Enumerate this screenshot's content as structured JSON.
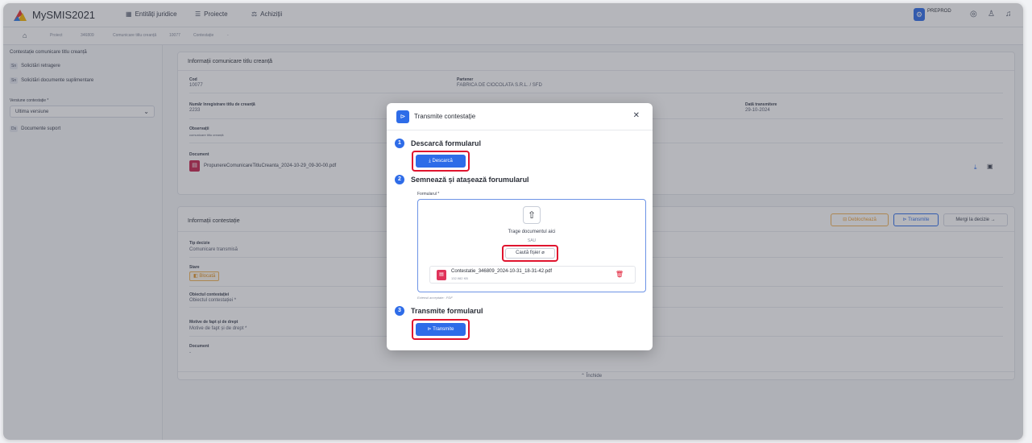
{
  "app": {
    "title": "MySMIS2021"
  },
  "nav": {
    "items": [
      "Entități juridice",
      "Proiecte",
      "Achiziții"
    ]
  },
  "topright": {
    "env_label": "PREPROD"
  },
  "breadcrumb": [
    "Proiect",
    "346809",
    "Comunicare titlu creanță",
    "10077",
    "Contestație",
    "-"
  ],
  "sidebar": {
    "title": "Contestație comunicare titlu creanță",
    "items": [
      {
        "tag": "Sn",
        "label": "Solicitări retragere"
      },
      {
        "tag": "Sn",
        "label": "Solicitări documente suplimentare"
      }
    ],
    "version_label": "Versiune contestație *",
    "version_value": "Ultima versiune",
    "docs_tag": "Ds",
    "docs_label": "Documente suport"
  },
  "info_card": {
    "title": "Informații comunicare titlu creanță",
    "cod_label": "Cod",
    "cod_value": "10077",
    "partener_label": "Partener",
    "partener_value": "FABRICA DE CIOCOLATA S.R.L. / SFD",
    "nr_label": "Număr înregistrare titlu de creanță",
    "nr_value": "2233",
    "data_label": "Dată transmitere",
    "data_value": "29-10-2024",
    "obs_label": "Observații",
    "obs_value": "comunicare titlu creanță",
    "doc_label": "Document",
    "doc_value": "PropunereComunicareTitluCreanta_2024-10-29_09-30-00.pdf"
  },
  "contest_card": {
    "title": "Informații contestație",
    "btn_deblocheaza": "Deblochează",
    "btn_transmite": "Transmite",
    "btn_mergi": "Mergi la decizie",
    "tip_label": "Tip decizie",
    "tip_value": "Comunicare transmisă",
    "stare_label": "Stare",
    "stare_value": "Blocată",
    "obiect_label": "Obiectul contestației",
    "obiect_value": "Obiectul contestației *",
    "motive_label": "Motive de fapt și de drept",
    "motive_value": "Motive de fapt și de drept *",
    "doc_label": "Document",
    "doc_value": "-",
    "collapse_label": "Închide"
  },
  "modal": {
    "title": "Transmite contestație",
    "step1_num": "1",
    "step1_title": "Descarcă formularul",
    "download_btn": "Descarcă",
    "step2_num": "2",
    "step2_title": "Semnează și atașează forumularul",
    "form_label": "Formularul *",
    "drop_text": "Trage documentul aici",
    "or_text": "SAU",
    "browse_btn": "Caută fișier",
    "file_name": "Contestatie_346809_2024-10-31_18-31-42.pdf",
    "file_size": "132.982 KB",
    "accepted": "Extensii acceptate: .PDF",
    "step3_num": "3",
    "step3_title": "Transmite formularul",
    "submit_btn": "Transmite"
  }
}
